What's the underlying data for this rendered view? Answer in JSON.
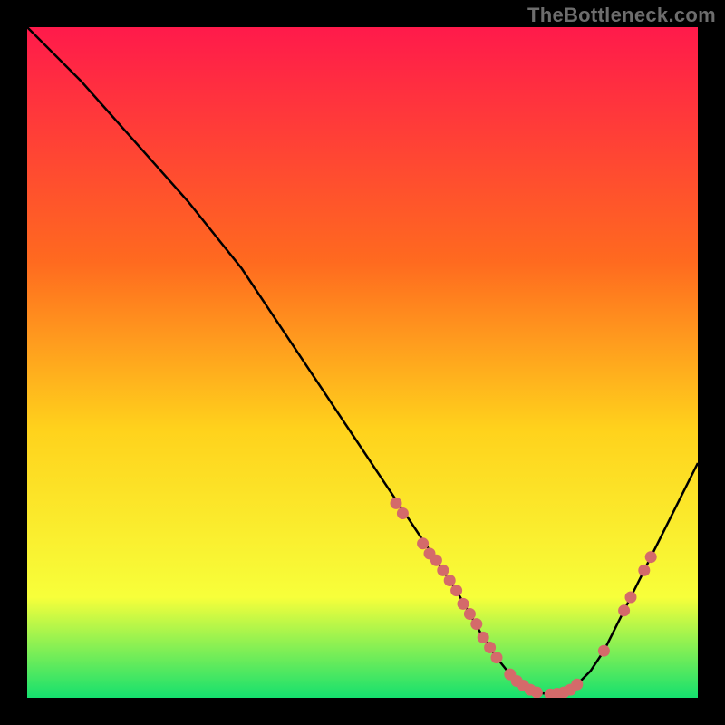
{
  "watermark": "TheBottleneck.com",
  "colors": {
    "background": "#000000",
    "gradient_top": "#ff1a4b",
    "gradient_mid1": "#ff6a1f",
    "gradient_mid2": "#ffd21c",
    "gradient_mid3": "#f7ff3a",
    "gradient_bottom": "#15e06e",
    "curve_stroke": "#000000",
    "marker_fill": "#d46a6a"
  },
  "chart_data": {
    "type": "line",
    "title": "",
    "xlabel": "",
    "ylabel": "",
    "xlim": [
      0,
      100
    ],
    "ylim": [
      0,
      100
    ],
    "series": [
      {
        "name": "bottleneck-curve",
        "x": [
          0,
          4,
          8,
          12,
          16,
          20,
          24,
          28,
          32,
          36,
          40,
          44,
          48,
          52,
          56,
          58,
          60,
          62,
          64,
          66,
          68,
          70,
          72,
          74,
          76,
          78,
          80,
          82,
          84,
          86,
          88,
          90,
          92,
          94,
          96,
          98,
          100
        ],
        "y": [
          100,
          96,
          92,
          87.5,
          83,
          78.5,
          74,
          69,
          64,
          58,
          52,
          46,
          40,
          34,
          28,
          25,
          22,
          19,
          16,
          12.5,
          9,
          6,
          3.5,
          1.8,
          0.8,
          0.5,
          0.8,
          2,
          4,
          7,
          11,
          15,
          19,
          23,
          27,
          31,
          35
        ]
      }
    ],
    "markers": {
      "name": "data-points",
      "x": [
        55,
        56,
        59,
        60,
        61,
        62,
        63,
        64,
        65,
        66,
        67,
        68,
        69,
        70,
        72,
        73,
        74,
        75,
        76,
        78,
        79,
        80,
        81,
        82,
        86,
        89,
        90,
        92,
        93
      ],
      "y": [
        29,
        27.5,
        23,
        21.5,
        20.5,
        19,
        17.5,
        16,
        14,
        12.5,
        11,
        9,
        7.5,
        6,
        3.5,
        2.5,
        1.8,
        1.2,
        0.8,
        0.5,
        0.6,
        0.8,
        1.2,
        2,
        7,
        13,
        15,
        19,
        21
      ]
    }
  }
}
